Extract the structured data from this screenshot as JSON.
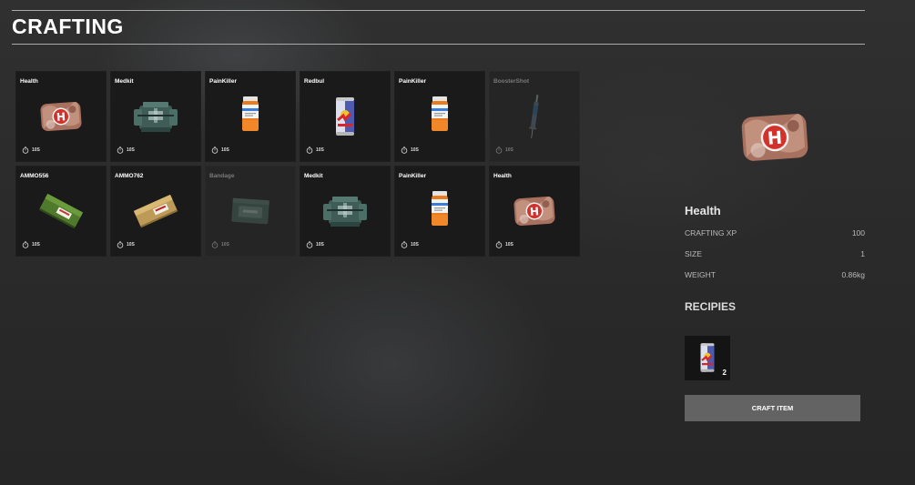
{
  "header": {
    "title": "CRAFTING"
  },
  "items": [
    {
      "name": "Health",
      "time": "10S",
      "icon": "health-icon",
      "enabled": true
    },
    {
      "name": "Medkit",
      "time": "10S",
      "icon": "medkit-icon",
      "enabled": true
    },
    {
      "name": "PainKiller",
      "time": "10S",
      "icon": "painkiller-icon",
      "enabled": true
    },
    {
      "name": "Redbul",
      "time": "10S",
      "icon": "energy-can-icon",
      "enabled": true
    },
    {
      "name": "PainKiller",
      "time": "10S",
      "icon": "painkiller-icon",
      "enabled": true
    },
    {
      "name": "BoosterShot",
      "time": "10S",
      "icon": "syringe-icon",
      "enabled": false
    },
    {
      "name": "AMMO556",
      "time": "10S",
      "icon": "ammo-green-icon",
      "enabled": true
    },
    {
      "name": "AMMO762",
      "time": "10S",
      "icon": "ammo-tan-icon",
      "enabled": true
    },
    {
      "name": "Bandage",
      "time": "10S",
      "icon": "bandage-icon",
      "enabled": false
    },
    {
      "name": "Medkit",
      "time": "10S",
      "icon": "medkit-icon",
      "enabled": true
    },
    {
      "name": "PainKiller",
      "time": "10S",
      "icon": "painkiller-icon",
      "enabled": true
    },
    {
      "name": "Health",
      "time": "10S",
      "icon": "health-icon",
      "enabled": true
    }
  ],
  "detail": {
    "name": "Health",
    "icon": "health-icon",
    "stats": [
      {
        "label": "CRAFTING XP",
        "value": "100"
      },
      {
        "label": "SIZE",
        "value": "1"
      },
      {
        "label": "WEIGHT",
        "value": "0.86kg"
      }
    ],
    "recipes_title": "RECIPIES",
    "recipes": [
      {
        "icon": "energy-can-icon",
        "qty": "2"
      }
    ],
    "craft_label": "CRAFT ITEM"
  }
}
